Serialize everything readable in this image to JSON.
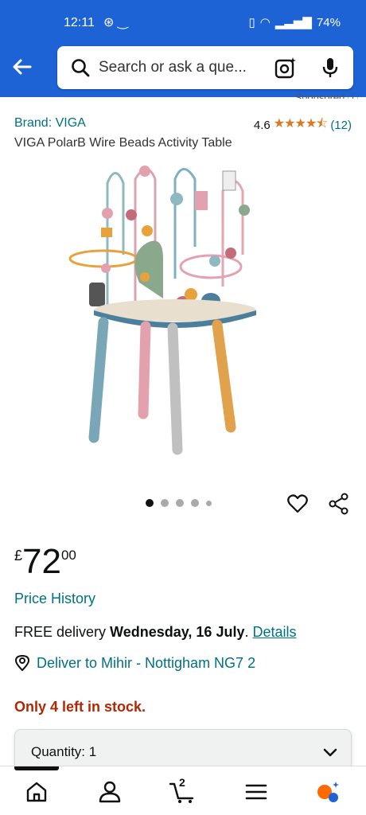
{
  "status_bar": {
    "time": "12:11",
    "battery": "74%"
  },
  "search": {
    "placeholder": "Search or ask a que..."
  },
  "sponsored": "Sponsored",
  "product": {
    "brand": "Brand: VIGA",
    "rating": "4.6",
    "stars": "★★★★⯪",
    "review_count": "(12)",
    "title": "VIGA PolarB Wire Beads Activity Table",
    "image_count": 5,
    "active_image": 1
  },
  "price": {
    "currency": "£",
    "whole": "72",
    "fraction": "00"
  },
  "price_history_link": "Price History",
  "delivery": {
    "prefix": "FREE delivery ",
    "date": "Wednesday, 16 July",
    "suffix": ". ",
    "details_link": "Details"
  },
  "deliver_to": "Deliver to Mihir - Nottigham NG7 2",
  "stock": "Only 4 left in stock.",
  "quantity": {
    "label": "Quantity: 1"
  },
  "bottom_nav": {
    "cart_count": "2"
  },
  "colors": {
    "header_blue": "#1d63d6",
    "link_teal": "#007185",
    "star_orange": "#de7921",
    "stock_red": "#b12704"
  },
  "icons": [
    "back-arrow-icon",
    "search-icon",
    "camera-lens-icon",
    "mic-icon",
    "heart-icon",
    "share-icon",
    "location-pin-icon",
    "chevron-down-icon",
    "home-icon",
    "account-icon",
    "cart-icon",
    "menu-icon",
    "ai-assistant-icon"
  ]
}
